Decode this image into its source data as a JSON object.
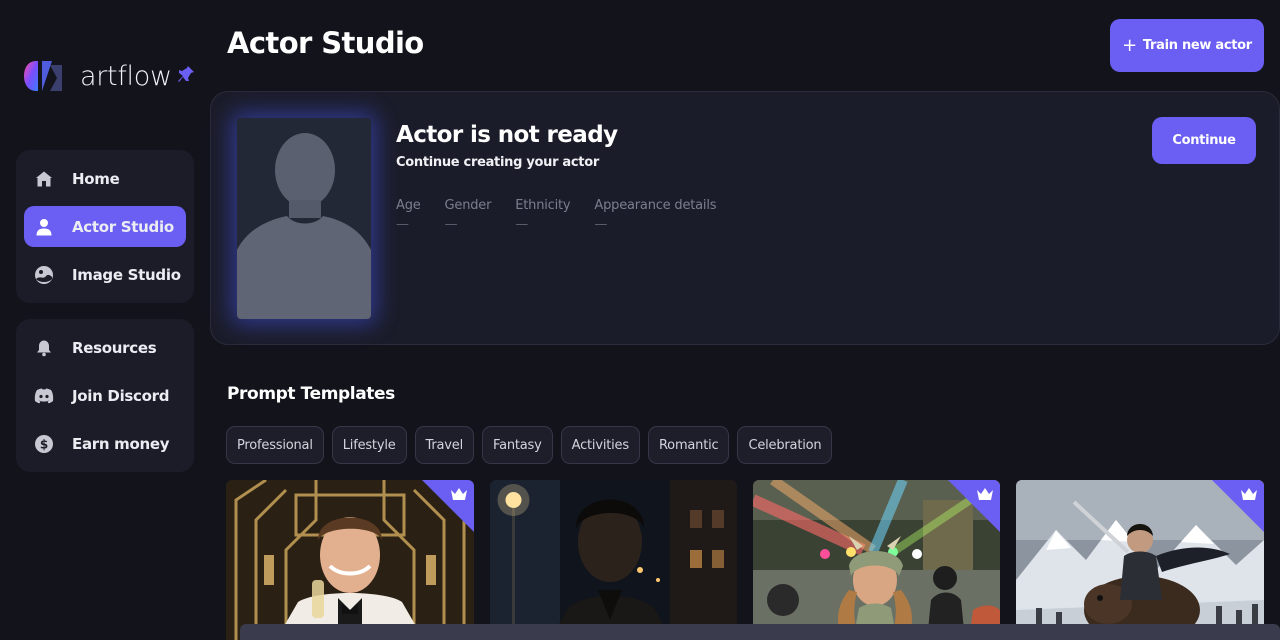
{
  "brand": {
    "name": "artflow"
  },
  "sidebar": {
    "primary": [
      {
        "label": "Home",
        "icon": "home-icon",
        "active": false
      },
      {
        "label": "Actor Studio",
        "icon": "user-icon",
        "active": true
      },
      {
        "label": "Image Studio",
        "icon": "image-studio-icon",
        "active": false
      }
    ],
    "secondary": [
      {
        "label": "Resources",
        "icon": "bell-icon"
      },
      {
        "label": "Join Discord",
        "icon": "discord-icon"
      },
      {
        "label": "Earn money",
        "icon": "dollar-icon"
      }
    ]
  },
  "header": {
    "title": "Actor Studio",
    "train_button": "Train new actor"
  },
  "actor": {
    "status": "Actor is not ready",
    "subtitle": "Continue creating your actor",
    "continue_button": "Continue",
    "attributes": [
      {
        "label": "Age",
        "value": "—"
      },
      {
        "label": "Gender",
        "value": "—"
      },
      {
        "label": "Ethnicity",
        "value": "—"
      },
      {
        "label": "Appearance details",
        "value": "—"
      }
    ]
  },
  "templates": {
    "title": "Prompt Templates",
    "categories": [
      "Professional",
      "Lifestyle",
      "Travel",
      "Fantasy",
      "Activities",
      "Romantic",
      "Celebration"
    ],
    "cards": [
      {
        "scene": "art-deco-celebration",
        "premium": true
      },
      {
        "scene": "night-street",
        "premium": false
      },
      {
        "scene": "costume-party",
        "premium": true
      },
      {
        "scene": "fantasy-bear-rider",
        "premium": true
      }
    ]
  },
  "colors": {
    "accent": "#6b5ef2",
    "background": "#12131b",
    "panel": "#1b1c27"
  }
}
